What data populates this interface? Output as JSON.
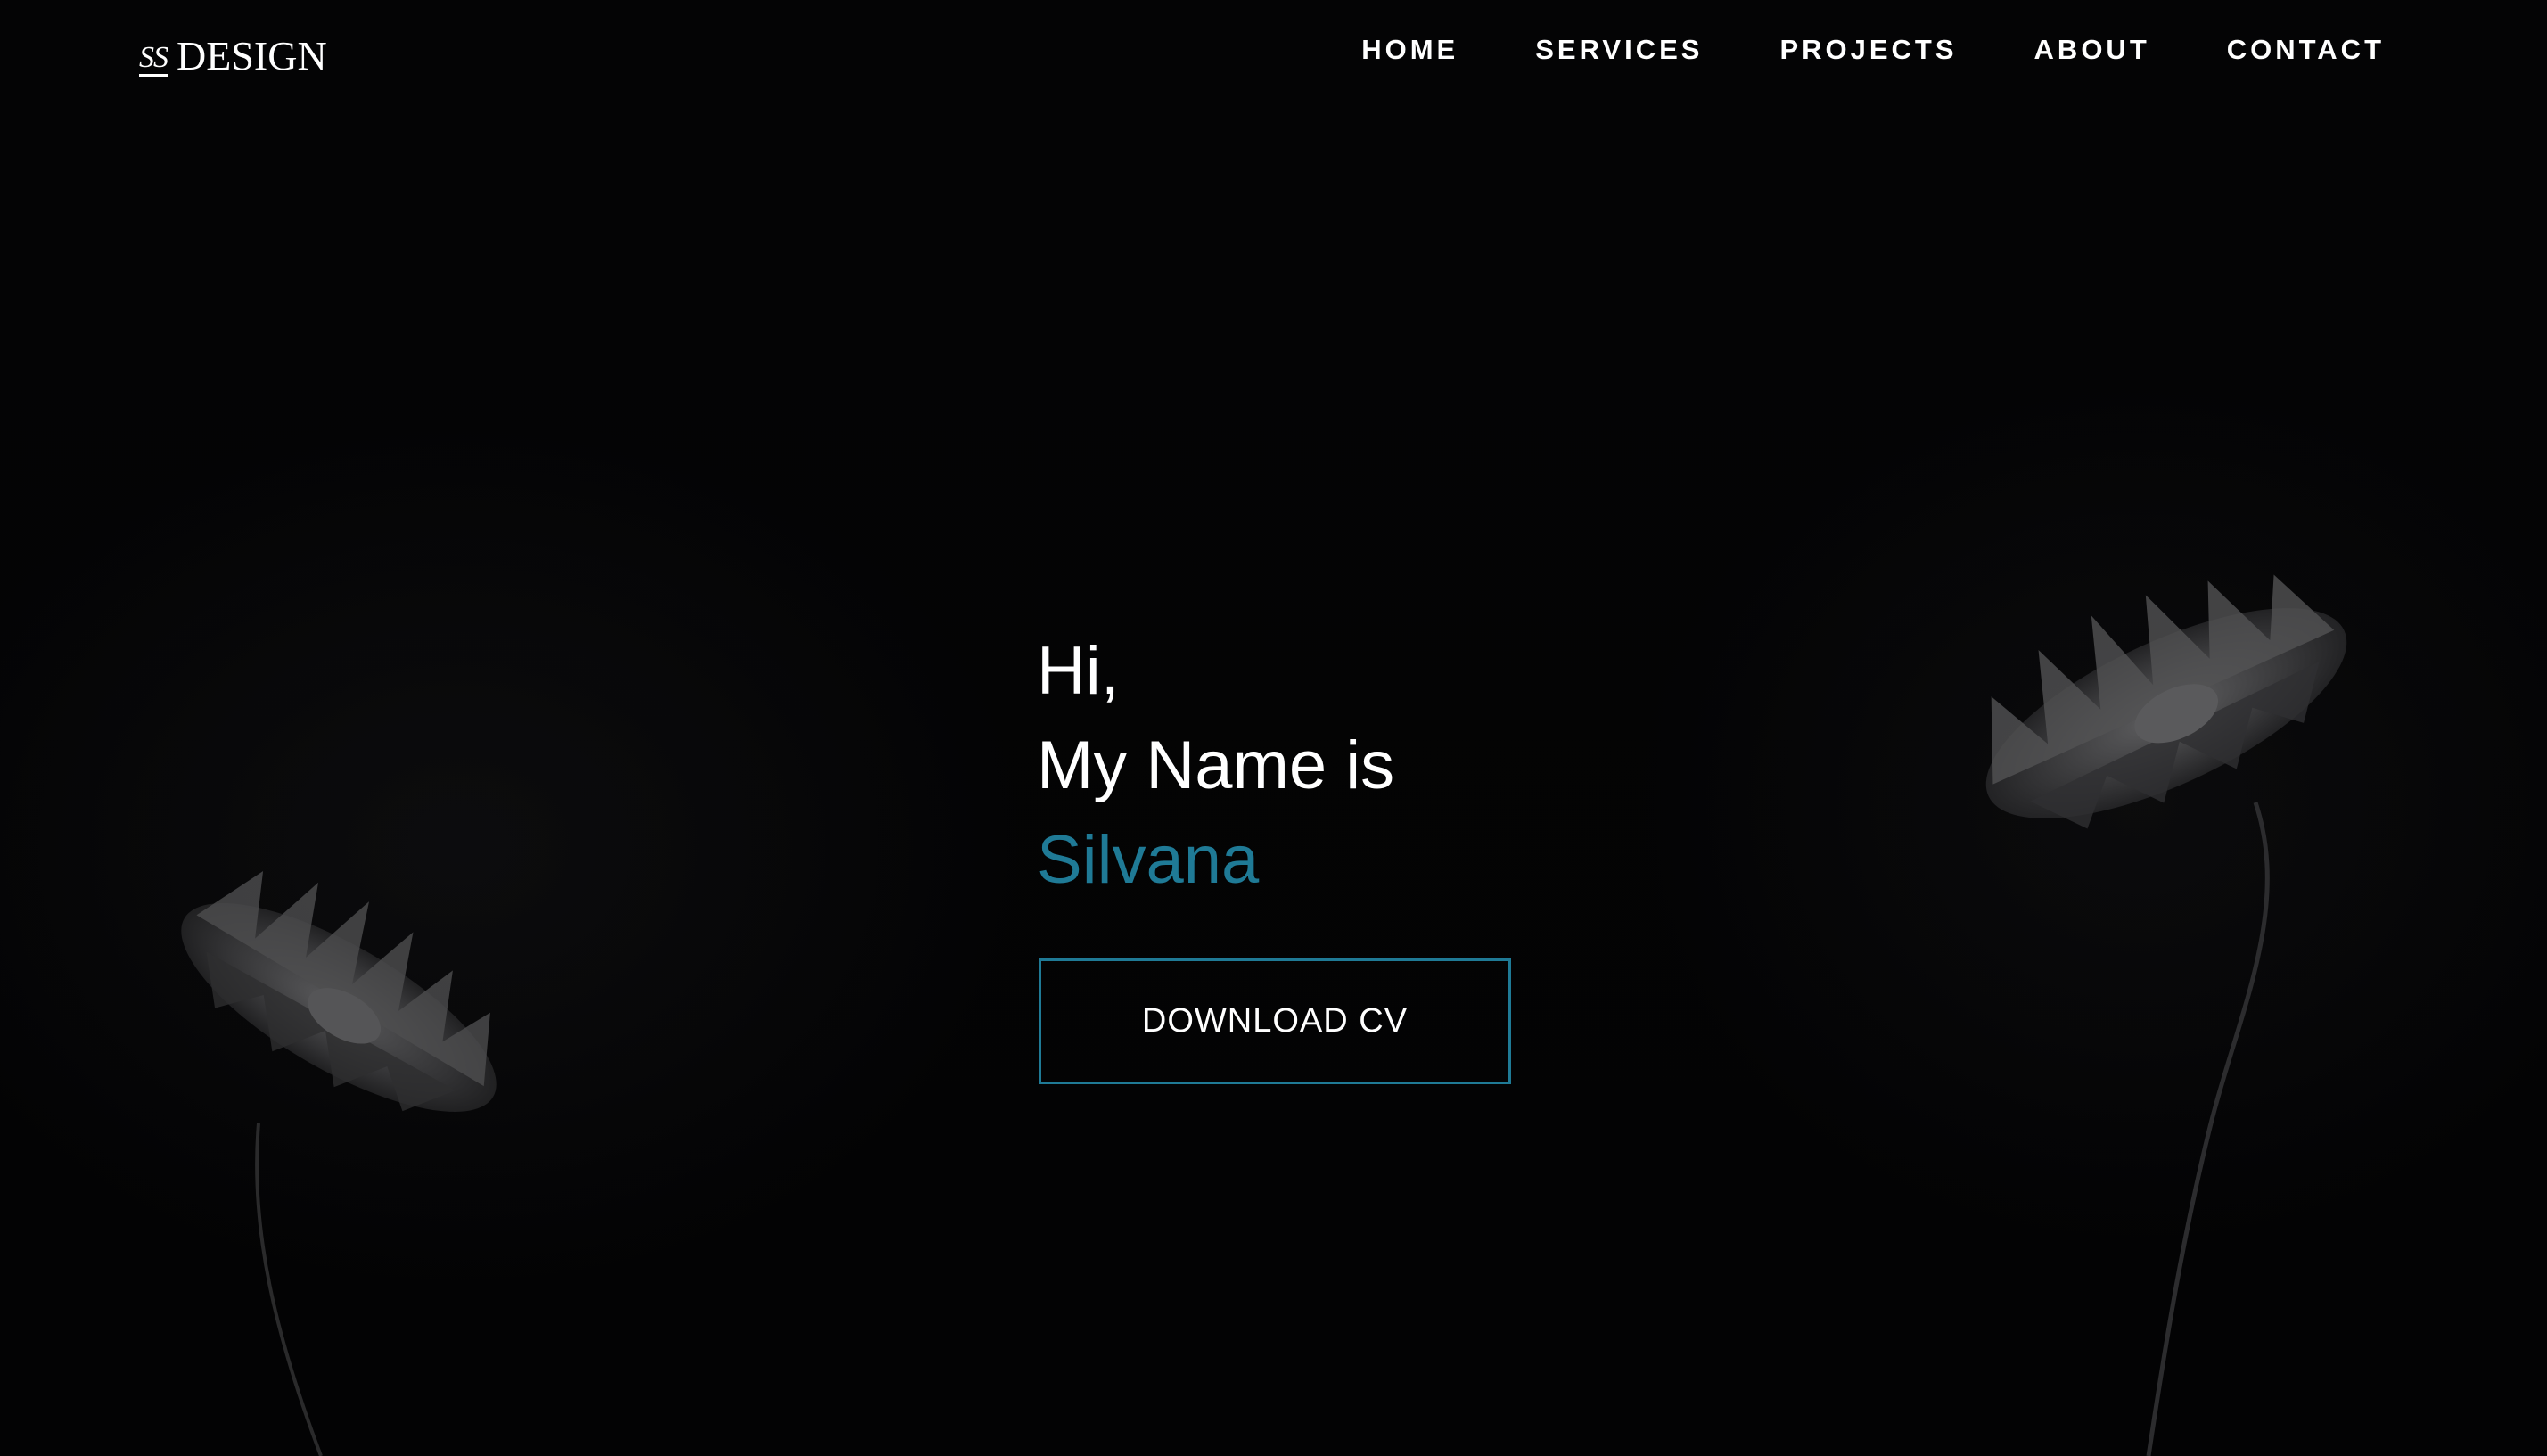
{
  "logo": {
    "mark": "SS",
    "text": "DESIGN"
  },
  "nav": {
    "items": [
      "HOME",
      "SERVICES",
      "PROJECTS",
      "ABOUT",
      "CONTACT"
    ]
  },
  "hero": {
    "greeting": "Hi,",
    "intro": "My Name is",
    "name": "Silvana",
    "cta_label": "DOWNLOAD CV"
  },
  "colors": {
    "accent": "#1f7a96",
    "background": "#030304",
    "text": "#ffffff"
  },
  "background_image": {
    "subject": "dark-flowers-icon"
  }
}
